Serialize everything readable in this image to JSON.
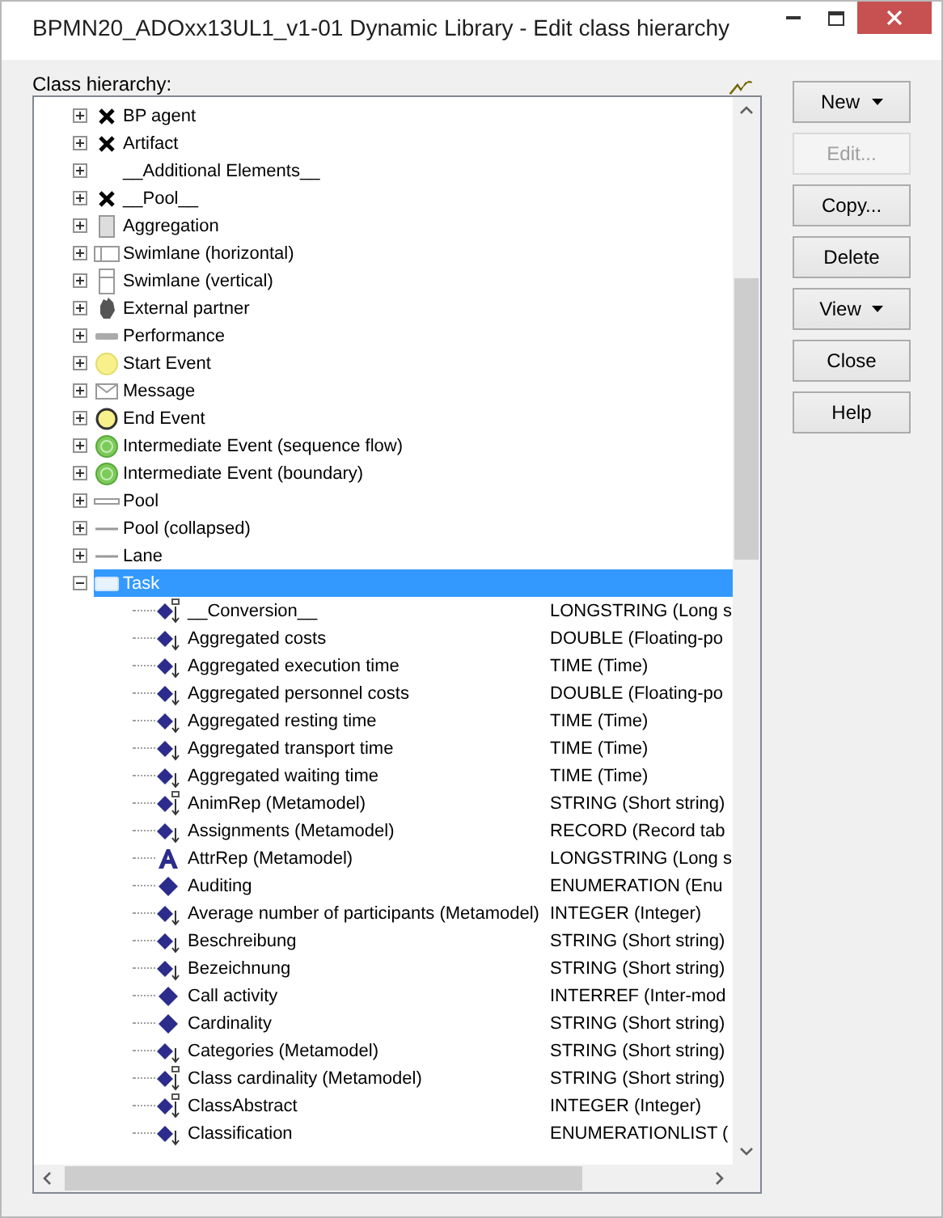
{
  "window": {
    "title": "BPMN20_ADOxx13UL1_v1-01 Dynamic Library - Edit class hierarchy"
  },
  "tree_label": "Class hierarchy:",
  "tree": [
    {
      "label": "BP agent",
      "kind": "cross",
      "expanded": false,
      "selected": false
    },
    {
      "label": "Artifact",
      "kind": "cross",
      "expanded": false,
      "selected": false
    },
    {
      "label": "__Additional Elements__",
      "kind": "blank",
      "expanded": false,
      "selected": false
    },
    {
      "label": "__Pool__",
      "kind": "cross",
      "expanded": false,
      "selected": false
    },
    {
      "label": "Aggregation",
      "kind": "block",
      "expanded": false,
      "selected": false
    },
    {
      "label": "Swimlane (horizontal)",
      "kind": "lane-h",
      "expanded": false,
      "selected": false
    },
    {
      "label": "Swimlane (vertical)",
      "kind": "lane-v",
      "expanded": false,
      "selected": false
    },
    {
      "label": "External partner",
      "kind": "partner",
      "expanded": false,
      "selected": false
    },
    {
      "label": "Performance",
      "kind": "bar",
      "expanded": false,
      "selected": false
    },
    {
      "label": "Start Event",
      "kind": "start",
      "expanded": false,
      "selected": false
    },
    {
      "label": "Message",
      "kind": "envelope",
      "expanded": false,
      "selected": false
    },
    {
      "label": "End Event",
      "kind": "end",
      "expanded": false,
      "selected": false
    },
    {
      "label": "Intermediate Event (sequence flow)",
      "kind": "intermediate",
      "expanded": false,
      "selected": false
    },
    {
      "label": "Intermediate Event (boundary)",
      "kind": "intermediate",
      "expanded": false,
      "selected": false
    },
    {
      "label": "Pool",
      "kind": "pool",
      "expanded": false,
      "selected": false
    },
    {
      "label": "Pool (collapsed)",
      "kind": "line",
      "expanded": false,
      "selected": false
    },
    {
      "label": "Lane",
      "kind": "line",
      "expanded": false,
      "selected": false
    },
    {
      "label": "Task",
      "kind": "task",
      "expanded": true,
      "selected": true,
      "children": [
        {
          "label": "__Conversion__",
          "kind": "table",
          "column_2": "LONGSTRING (Long s",
          "selected": false
        },
        {
          "label": "Aggregated costs",
          "kind": "arrow",
          "column_2": "DOUBLE (Floating-po",
          "selected": false
        },
        {
          "label": "Aggregated execution time",
          "kind": "arrow",
          "column_2": "TIME (Time)",
          "selected": false
        },
        {
          "label": "Aggregated personnel costs",
          "kind": "arrow",
          "column_2": "DOUBLE (Floating-po",
          "selected": false
        },
        {
          "label": "Aggregated resting time",
          "kind": "arrow",
          "column_2": "TIME (Time)",
          "selected": false
        },
        {
          "label": "Aggregated transport time",
          "kind": "arrow",
          "column_2": "TIME (Time)",
          "selected": false
        },
        {
          "label": "Aggregated waiting time",
          "kind": "arrow",
          "column_2": "TIME (Time)",
          "selected": false
        },
        {
          "label": "AnimRep (Metamodel)",
          "kind": "table",
          "column_2": "STRING (Short string)",
          "selected": false
        },
        {
          "label": "Assignments (Metamodel)",
          "kind": "arrow",
          "column_2": "RECORD (Record tab",
          "selected": false
        },
        {
          "label": "AttrRep (Metamodel)",
          "kind": "letter",
          "column_2": "LONGSTRING (Long s",
          "selected": false
        },
        {
          "label": "Auditing",
          "kind": "diamond",
          "column_2": "ENUMERATION (Enu",
          "selected": false
        },
        {
          "label": "Average number of participants (Metamodel)",
          "kind": "arrow",
          "column_2": "INTEGER (Integer)",
          "selected": false
        },
        {
          "label": "Beschreibung",
          "kind": "arrow",
          "column_2": "STRING (Short string)",
          "selected": false
        },
        {
          "label": "Bezeichnung",
          "kind": "arrow",
          "column_2": "STRING (Short string)",
          "selected": false
        },
        {
          "label": "Call activity",
          "kind": "diamond",
          "column_2": "INTERREF (Inter-mod",
          "selected": false
        },
        {
          "label": "Cardinality",
          "kind": "diamond",
          "column_2": "STRING (Short string)",
          "selected": false
        },
        {
          "label": "Categories (Metamodel)",
          "kind": "arrow",
          "column_2": "STRING (Short string)",
          "selected": false
        },
        {
          "label": "Class cardinality (Metamodel)",
          "kind": "table",
          "column_2": "STRING (Short string)",
          "selected": false
        },
        {
          "label": "ClassAbstract",
          "kind": "table",
          "column_2": "INTEGER (Integer)",
          "selected": false
        },
        {
          "label": "Classification",
          "kind": "arrow",
          "column_2": "ENUMERATIONLIST (",
          "selected": false
        }
      ]
    }
  ],
  "buttons": [
    {
      "label": "New",
      "dropdown": true,
      "disabled": false
    },
    {
      "label": "Edit...",
      "dropdown": false,
      "disabled": true
    },
    {
      "label": "Copy...",
      "dropdown": false,
      "disabled": false
    },
    {
      "label": "Delete",
      "dropdown": false,
      "disabled": false
    },
    {
      "label": "View",
      "dropdown": true,
      "disabled": false
    },
    {
      "label": "Close",
      "dropdown": false,
      "disabled": false
    },
    {
      "label": "Help",
      "dropdown": false,
      "disabled": false
    }
  ]
}
